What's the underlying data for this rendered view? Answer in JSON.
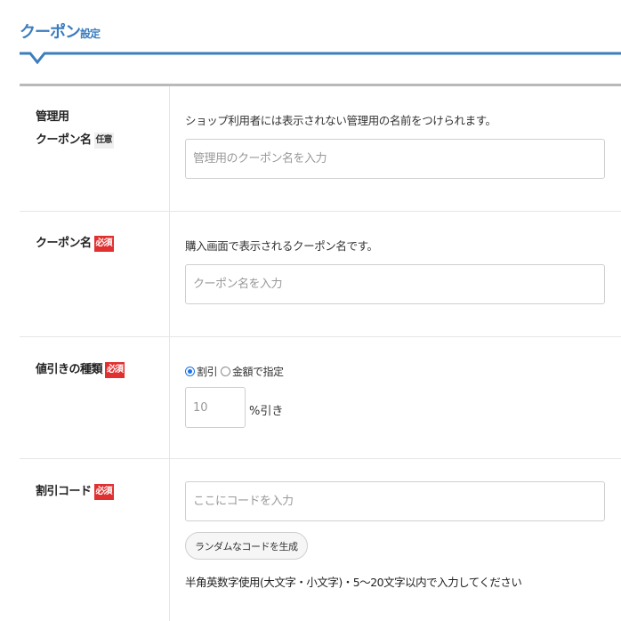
{
  "section": {
    "title_main": "クーポン",
    "title_sub": "設定"
  },
  "fields": {
    "management_name": {
      "label_line1": "管理用",
      "label_line2": "クーポン名",
      "badge": "任意",
      "description": "ショップ利用者には表示されない管理用の名前をつけられます。",
      "placeholder": "管理用のクーポン名を入力",
      "value": ""
    },
    "coupon_name": {
      "label": "クーポン名",
      "badge": "必須",
      "description": "購入画面で表示されるクーポン名です。",
      "placeholder": "クーポン名を入力",
      "value": ""
    },
    "discount_type": {
      "label": "値引きの種類",
      "badge": "必須",
      "options": [
        {
          "label": "割引",
          "checked": true
        },
        {
          "label": "金額で指定",
          "checked": false
        }
      ],
      "amount_placeholder": "10",
      "unit": "%引き"
    },
    "discount_code": {
      "label": "割引コード",
      "badge": "必須",
      "placeholder": "ここにコードを入力",
      "value": "",
      "generate_button": "ランダムなコードを生成",
      "help_text": "半角英数字使用(大文字・小文字)・5〜20文字以内で入力してください"
    }
  },
  "colors": {
    "accent": "#3b7dbf",
    "required_badge": "#e03030",
    "optional_badge": "#efefef",
    "radio_checked": "#1a73e8"
  }
}
